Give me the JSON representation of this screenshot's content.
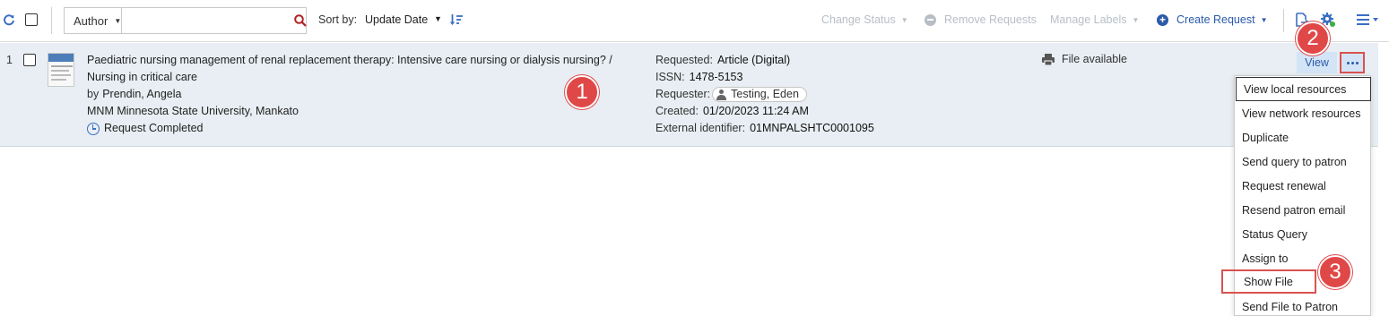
{
  "toolbar": {
    "search_field_select": "Author",
    "search_value": "",
    "sort_by_label": "Sort by:",
    "sort_by_value": "Update Date",
    "change_status": "Change Status",
    "remove_requests": "Remove Requests",
    "manage_labels": "Manage Labels",
    "create_request": "Create Request"
  },
  "icons": {
    "refresh": "refresh-icon",
    "search": "search-icon",
    "sort_direction": "sort-descending-icon",
    "export": "export-icon",
    "settings": "gear-icon",
    "list_view": "list-view-icon",
    "status": "clock-icon",
    "file": "printer-icon",
    "requester": "user-icon"
  },
  "colors": {
    "accent": "#2a5aa8",
    "row_background": "#e8eef3",
    "callout": "#e04848",
    "disabled": "#b8bec6",
    "settings_status_dot": "#3cb043"
  },
  "row": {
    "number": "1",
    "title_line1": "Paediatric nursing management of renal replacement therapy: Intensive care nursing or dialysis nursing? /",
    "title_line2": "Nursing in critical care",
    "by_label": "by",
    "author": "Prendin, Angela",
    "library": "MNM Minnesota State University, Mankato",
    "status": "Request Completed",
    "requested_label": "Requested:",
    "requested_value": "Article (Digital)",
    "issn_label": "ISSN:",
    "issn_value": "1478-5153",
    "requester_label": "Requester:",
    "requester_value": "Testing, Eden",
    "created_label": "Created:",
    "created_value": "01/20/2023 11:24 AM",
    "external_id_label": "External identifier:",
    "external_id_value": "01MNPALSHTC0001095",
    "file_status": "File available",
    "view_button": "View"
  },
  "menu": {
    "items": [
      "View local resources",
      "View network resources",
      "Duplicate",
      "Send query to patron",
      "Request renewal",
      "Resend patron email",
      "Status Query",
      "Assign to",
      "Show File",
      "Send File to Patron"
    ]
  },
  "callouts": [
    "1",
    "2",
    "3"
  ]
}
